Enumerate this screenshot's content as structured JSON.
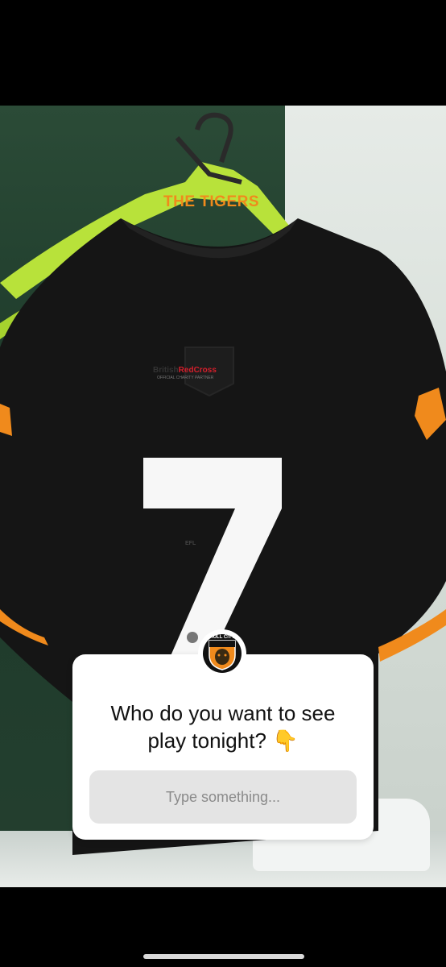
{
  "story": {
    "background_description_only_visual": true,
    "shirt": {
      "collar_text": "THE TIGERS",
      "number": "7",
      "sponsor_line1": "British",
      "sponsor_line1_red": "RedCross",
      "sponsor_line2": "OFFICIAL CHARITY PARTNER",
      "league_badge": "EFL"
    }
  },
  "question_sticker": {
    "avatar_text": "HULL CITY",
    "question_line1": "Who do you want to see",
    "question_line2": "play tonight?",
    "question_emoji": "👇",
    "answer_placeholder": "Type something..."
  },
  "colors": {
    "shirt_black": "#151515",
    "orange_accent": "#f08a1c",
    "hanger_green": "#b8e23a"
  }
}
